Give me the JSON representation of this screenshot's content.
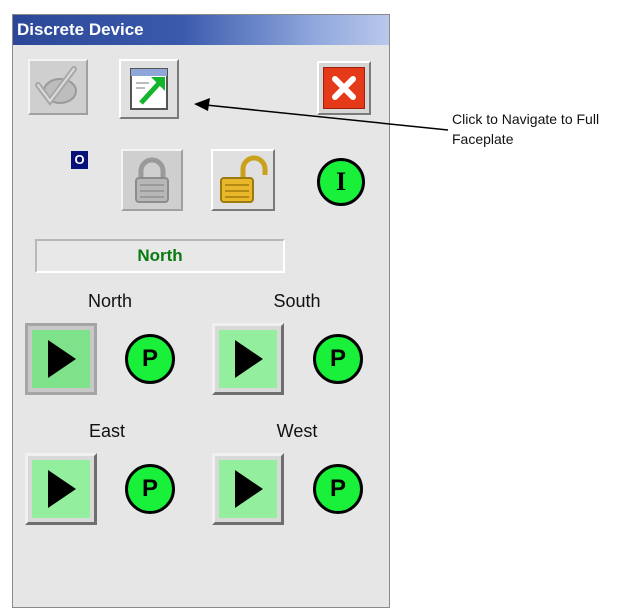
{
  "window": {
    "title": "Discrete Device"
  },
  "toolbar": {
    "acknowledge_icon": "acknowledge-check-icon",
    "navigate_icon": "navigate-faceplate-icon",
    "close_icon": "close-x-icon",
    "colors": {
      "close_bg": "#e53a1a"
    }
  },
  "status": {
    "mode_badge": "O",
    "state_text": "North",
    "interlock_indicator": "I",
    "colors": {
      "indicator": "#19f03a",
      "state_text": "#0a7a10"
    }
  },
  "commands": [
    {
      "label": "North",
      "permissive": "P",
      "active": true
    },
    {
      "label": "South",
      "permissive": "P",
      "active": false
    },
    {
      "label": "East",
      "permissive": "P",
      "active": false
    },
    {
      "label": "West",
      "permissive": "P",
      "active": false
    }
  ],
  "annotation": {
    "text": "Click to Navigate to Full Faceplate"
  }
}
